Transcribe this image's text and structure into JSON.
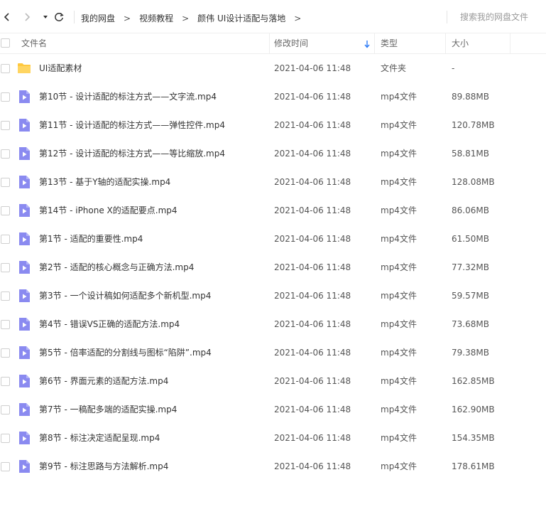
{
  "toolbar": {
    "breadcrumb": [
      "我的网盘",
      "视频教程",
      "颜伟 UI设计适配与落地"
    ],
    "breadcrumb_sep": ">",
    "search_placeholder": "搜索我的网盘文件"
  },
  "icons": {
    "back": "chevron-left-icon",
    "forward": "chevron-right-icon",
    "dropdown": "caret-down-icon",
    "refresh": "refresh-icon",
    "folder": "folder-icon",
    "video": "video-file-icon",
    "sort": "sort-down-arrow-icon"
  },
  "colors": {
    "folder": "#ffc83d",
    "video": "#8a8af0",
    "sort_arrow": "#2f7cf6"
  },
  "columns": {
    "name": "文件名",
    "modified": "修改时间",
    "type": "类型",
    "size": "大小"
  },
  "files": [
    {
      "name": "UI适配素材",
      "date": "2021-04-06 11:48",
      "type": "文件夹",
      "size": "-",
      "kind": "folder"
    },
    {
      "name": "第10节 - 设计适配的标注方式——文字流.mp4",
      "date": "2021-04-06 11:48",
      "type": "mp4文件",
      "size": "89.88MB",
      "kind": "video"
    },
    {
      "name": "第11节 - 设计适配的标注方式——弹性控件.mp4",
      "date": "2021-04-06 11:48",
      "type": "mp4文件",
      "size": "120.78MB",
      "kind": "video"
    },
    {
      "name": "第12节 - 设计适配的标注方式——等比缩放.mp4",
      "date": "2021-04-06 11:48",
      "type": "mp4文件",
      "size": "58.81MB",
      "kind": "video"
    },
    {
      "name": "第13节 - 基于Y轴的适配实操.mp4",
      "date": "2021-04-06 11:48",
      "type": "mp4文件",
      "size": "128.08MB",
      "kind": "video"
    },
    {
      "name": "第14节 - iPhone X的适配要点.mp4",
      "date": "2021-04-06 11:48",
      "type": "mp4文件",
      "size": "86.06MB",
      "kind": "video"
    },
    {
      "name": "第1节 - 适配的重要性.mp4",
      "date": "2021-04-06 11:48",
      "type": "mp4文件",
      "size": "61.50MB",
      "kind": "video"
    },
    {
      "name": "第2节 - 适配的核心概念与正确方法.mp4",
      "date": "2021-04-06 11:48",
      "type": "mp4文件",
      "size": "77.32MB",
      "kind": "video"
    },
    {
      "name": "第3节 - 一个设计稿如何适配多个新机型.mp4",
      "date": "2021-04-06 11:48",
      "type": "mp4文件",
      "size": "59.57MB",
      "kind": "video"
    },
    {
      "name": "第4节 - 错误VS正确的适配方法.mp4",
      "date": "2021-04-06 11:48",
      "type": "mp4文件",
      "size": "73.68MB",
      "kind": "video"
    },
    {
      "name": "第5节 - 倍率适配的分割线与图标“陷阱”.mp4",
      "date": "2021-04-06 11:48",
      "type": "mp4文件",
      "size": "79.38MB",
      "kind": "video"
    },
    {
      "name": "第6节 - 界面元素的适配方法.mp4",
      "date": "2021-04-06 11:48",
      "type": "mp4文件",
      "size": "162.85MB",
      "kind": "video"
    },
    {
      "name": "第7节 - 一稿配多端的适配实操.mp4",
      "date": "2021-04-06 11:48",
      "type": "mp4文件",
      "size": "162.90MB",
      "kind": "video"
    },
    {
      "name": "第8节 - 标注决定适配呈现.mp4",
      "date": "2021-04-06 11:48",
      "type": "mp4文件",
      "size": "154.35MB",
      "kind": "video"
    },
    {
      "name": "第9节 - 标注思路与方法解析.mp4",
      "date": "2021-04-06 11:48",
      "type": "mp4文件",
      "size": "178.61MB",
      "kind": "video"
    }
  ]
}
